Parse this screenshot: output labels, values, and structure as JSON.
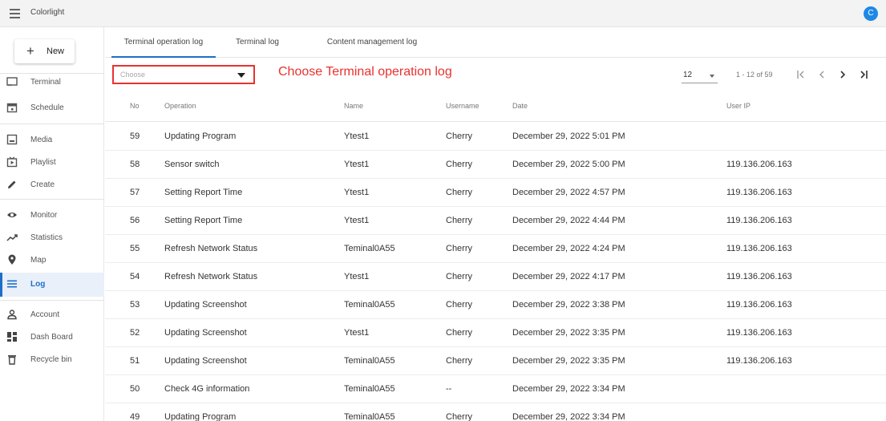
{
  "app": {
    "title": "Colorlight",
    "avatar_letter": "C"
  },
  "sidebar": {
    "new_label": "New",
    "items": [
      {
        "label": "Terminal",
        "icon": "terminal-icon"
      },
      {
        "label": "Schedule",
        "icon": "calendar-icon"
      },
      {
        "label": "Media",
        "icon": "media-icon"
      },
      {
        "label": "Playlist",
        "icon": "playlist-icon"
      },
      {
        "label": "Create",
        "icon": "pencil-icon"
      },
      {
        "label": "Monitor",
        "icon": "eye-icon"
      },
      {
        "label": "Statistics",
        "icon": "trend-icon"
      },
      {
        "label": "Map",
        "icon": "map-pin-icon"
      },
      {
        "label": "Log",
        "icon": "log-icon",
        "active": true
      },
      {
        "label": "Account",
        "icon": "user-icon"
      },
      {
        "label": "Dash Board",
        "icon": "dashboard-icon"
      },
      {
        "label": "Recycle bin",
        "icon": "trash-icon"
      }
    ]
  },
  "tabs": [
    {
      "label": "Terminal operation log",
      "active": true
    },
    {
      "label": "Terminal log"
    },
    {
      "label": "Content management log"
    }
  ],
  "filter": {
    "placeholder": "Choose",
    "annotation": "Choose Terminal operation log"
  },
  "pager": {
    "page_size": "12",
    "range": "1 - 12 of 59"
  },
  "table": {
    "headers": {
      "no": "No",
      "operation": "Operation",
      "name": "Name",
      "username": "Username",
      "date": "Date",
      "ip": "User IP"
    },
    "rows": [
      {
        "no": "59",
        "operation": "Updating Program",
        "name": "Ytest1",
        "username": "Cherry",
        "date": "December 29, 2022 5:01 PM",
        "ip": ""
      },
      {
        "no": "58",
        "operation": "Sensor switch",
        "name": "Ytest1",
        "username": "Cherry",
        "date": "December 29, 2022 5:00 PM",
        "ip": "119.136.206.163"
      },
      {
        "no": "57",
        "operation": "Setting Report Time",
        "name": "Ytest1",
        "username": "Cherry",
        "date": "December 29, 2022 4:57 PM",
        "ip": "119.136.206.163"
      },
      {
        "no": "56",
        "operation": "Setting Report Time",
        "name": "Ytest1",
        "username": "Cherry",
        "date": "December 29, 2022 4:44 PM",
        "ip": "119.136.206.163"
      },
      {
        "no": "55",
        "operation": "Refresh Network Status",
        "name": "Teminal0A55",
        "username": "Cherry",
        "date": "December 29, 2022 4:24 PM",
        "ip": "119.136.206.163"
      },
      {
        "no": "54",
        "operation": "Refresh Network Status",
        "name": "Ytest1",
        "username": "Cherry",
        "date": "December 29, 2022 4:17 PM",
        "ip": "119.136.206.163"
      },
      {
        "no": "53",
        "operation": "Updating Screenshot",
        "name": "Teminal0A55",
        "username": "Cherry",
        "date": "December 29, 2022 3:38 PM",
        "ip": "119.136.206.163"
      },
      {
        "no": "52",
        "operation": "Updating Screenshot",
        "name": "Ytest1",
        "username": "Cherry",
        "date": "December 29, 2022 3:35 PM",
        "ip": "119.136.206.163"
      },
      {
        "no": "51",
        "operation": "Updating Screenshot",
        "name": "Teminal0A55",
        "username": "Cherry",
        "date": "December 29, 2022 3:35 PM",
        "ip": "119.136.206.163"
      },
      {
        "no": "50",
        "operation": "Check 4G information",
        "name": "Teminal0A55",
        "username": "--",
        "date": "December 29, 2022 3:34 PM",
        "ip": ""
      },
      {
        "no": "49",
        "operation": "Updating Program",
        "name": "Teminal0A55",
        "username": "Cherry",
        "date": "December 29, 2022 3:34 PM",
        "ip": ""
      }
    ]
  },
  "colors": {
    "accent": "#1e6fc9",
    "annotation": "#e8322f",
    "avatar": "#1e88e5"
  }
}
